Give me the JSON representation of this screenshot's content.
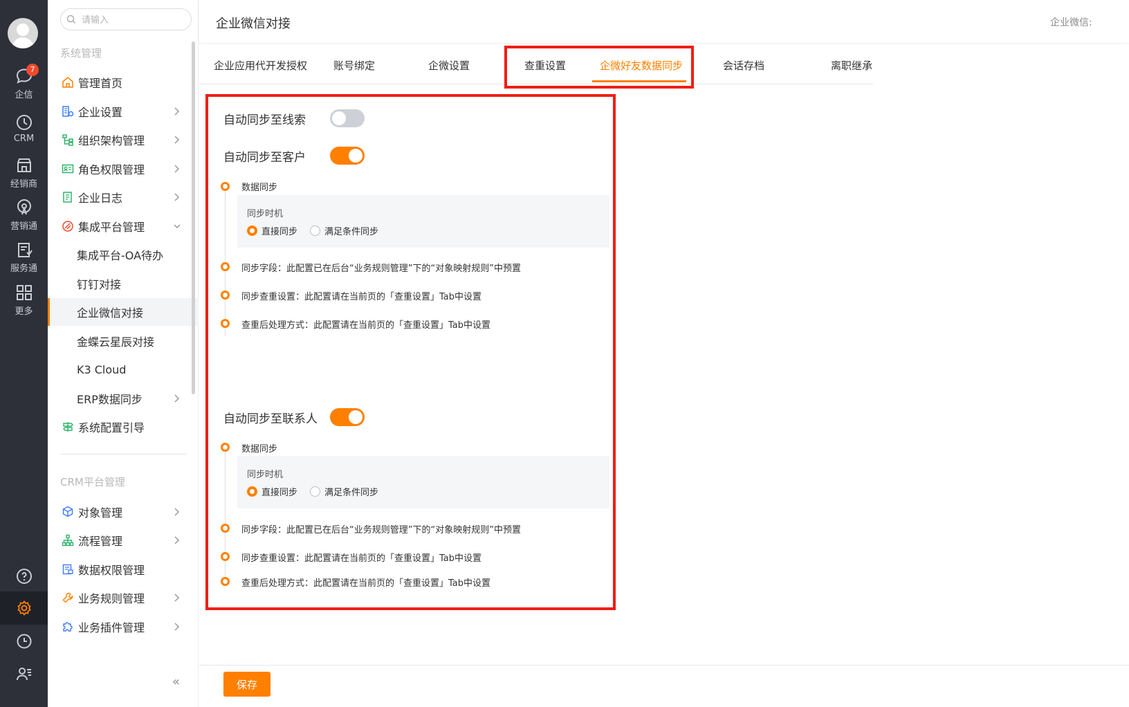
{
  "rail": {
    "badge": "7",
    "items": [
      {
        "label": "企信",
        "icon": "chat-bubble-icon"
      },
      {
        "label": "CRM",
        "icon": "clock-icon"
      },
      {
        "label": "经销商",
        "icon": "store-icon"
      },
      {
        "label": "营销通",
        "icon": "broadcast-icon"
      },
      {
        "label": "服务通",
        "icon": "service-clipboard-icon"
      },
      {
        "label": "更多",
        "icon": "grid-icon"
      }
    ],
    "bottom": [
      "help-icon",
      "settings-icon",
      "history-icon",
      "user-list-icon"
    ]
  },
  "menu": {
    "search_placeholder": "请输入",
    "section_system": "系统管理",
    "items": [
      {
        "label": "管理首页"
      },
      {
        "label": "企业设置"
      },
      {
        "label": "组织架构管理"
      },
      {
        "label": "角色权限管理"
      },
      {
        "label": "企业日志"
      },
      {
        "label": "集成平台管理"
      },
      {
        "label": "集成平台-OA待办"
      },
      {
        "label": "钉钉对接"
      },
      {
        "label": "企业微信对接"
      },
      {
        "label": "金蝶云星辰对接"
      },
      {
        "label": "K3 Cloud"
      },
      {
        "label": "ERP数据同步"
      },
      {
        "label": "系统配置引导"
      }
    ],
    "section_crm": "CRM平台管理",
    "crm_items": [
      {
        "label": "对象管理"
      },
      {
        "label": "流程管理"
      },
      {
        "label": "数据权限管理"
      },
      {
        "label": "业务规则管理"
      },
      {
        "label": "业务插件管理"
      }
    ],
    "collapse_glyph": "«"
  },
  "header": {
    "title": "企业微信对接",
    "right_text": "企业微信:"
  },
  "tabs": [
    {
      "label": "企业应用代开发授权"
    },
    {
      "label": "账号绑定"
    },
    {
      "label": "企微设置"
    },
    {
      "label": "查重设置"
    },
    {
      "label": "企微好友数据同步",
      "active": true
    },
    {
      "label": "会话存档"
    },
    {
      "label": "离职继承"
    }
  ],
  "content": {
    "lead": {
      "label": "自动同步至线索",
      "enabled": false
    },
    "customer": {
      "label": "自动同步至客户",
      "enabled": true,
      "data_sync": "数据同步",
      "timing_title": "同步时机",
      "options": [
        "直接同步",
        "满足条件同步"
      ],
      "selected": "直接同步",
      "field_note": "同步字段：此配置已在后台“业务规则管理”下的“对象映射规则”中预置",
      "dup_note": "同步查重设置：此配置请在当前页的「查重设置」Tab中设置",
      "post_note": "查重后处理方式：此配置请在当前页的「查重设置」Tab中设置"
    },
    "contact": {
      "label": "自动同步至联系人",
      "enabled": true,
      "data_sync": "数据同步",
      "timing_title": "同步时机",
      "options": [
        "直接同步",
        "满足条件同步"
      ],
      "selected": "直接同步",
      "field_note": "同步字段：此配置已在后台“业务规则管理”下的“对象映射规则”中预置",
      "dup_note": "同步查重设置：此配置请在当前页的「查重设置」Tab中设置",
      "post_note": "查重后处理方式：此配置请在当前页的「查重设置」Tab中设置"
    }
  },
  "footer": {
    "save_label": "保存"
  },
  "colors": {
    "accent": "#ff8000",
    "highlight": "#f01e14",
    "rail_bg": "#2d3039"
  }
}
